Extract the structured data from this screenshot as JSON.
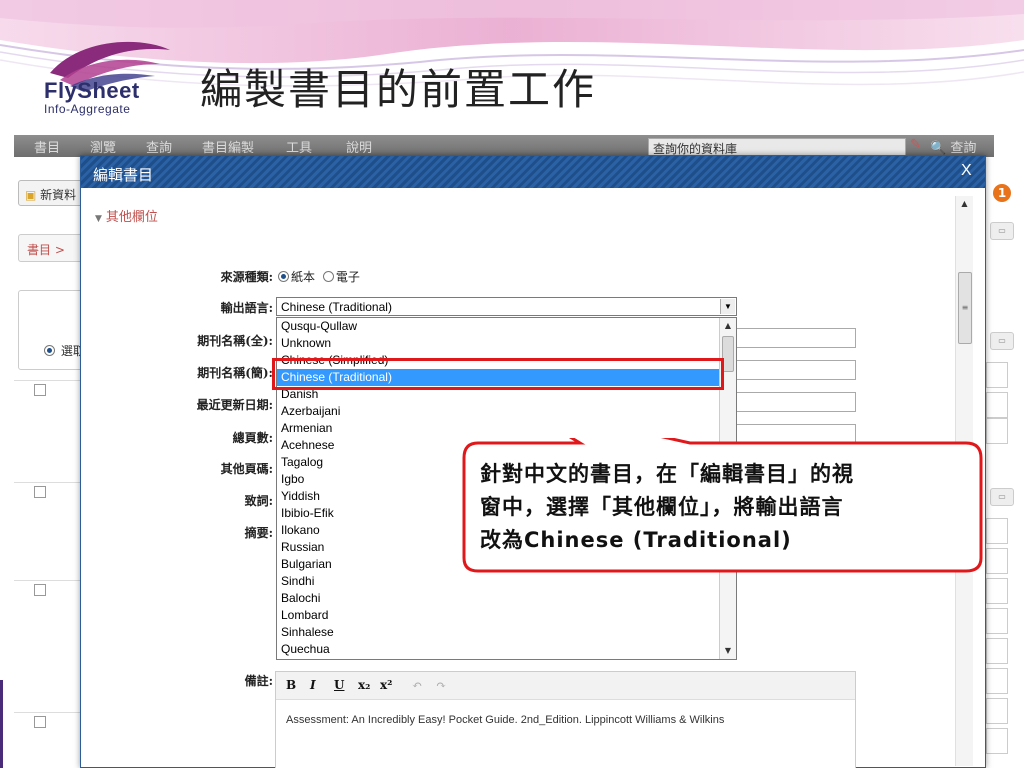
{
  "slide": {
    "logo_main": "FlySheet",
    "logo_sub": "Info-Aggregate",
    "title": "編製書目的前置工作"
  },
  "app": {
    "menu": [
      "書目",
      "瀏覽",
      "查詢",
      "書目編製",
      "工具",
      "說明"
    ],
    "search_placeholder": "查詢你的資料庫",
    "search_button": "查詢",
    "new_button": "新資料",
    "breadcrumb": "書目 >",
    "radio_label": "選取",
    "badge_count": "1"
  },
  "dialog": {
    "title": "編輯書目",
    "close": "X",
    "section": "其他欄位",
    "fields": {
      "source_type": "來源種類:",
      "output_language": "輸出語言:",
      "journal_full": "期刊名稱(全):",
      "journal_abbr": "期刊名稱(簡):",
      "last_updated": "最近更新日期:",
      "total_pages": "總頁數:",
      "other_pages": "其他頁碼:",
      "acknowledgement": "致詞:",
      "abstract": "摘要:",
      "notes": "備註:"
    },
    "source_options": [
      "紙本",
      "電子"
    ],
    "source_selected": "紙本",
    "output_language_value": "Chinese (Traditional)",
    "language_options": [
      "Qusqu-Qullaw",
      "Unknown",
      "Chinese (Simplified)",
      "Chinese (Traditional)",
      "Danish",
      "Azerbaijani",
      "Armenian",
      "Acehnese",
      "Tagalog",
      "Igbo",
      "Yiddish",
      "Ibibio-Efik",
      "Ilokano",
      "Russian",
      "Bulgarian",
      "Sindhi",
      "Balochi",
      "Lombard",
      "Sinhalese",
      "Quechua"
    ],
    "editor_toolbar": [
      "B",
      "I",
      "U",
      "x₂",
      "x²",
      "↶",
      "↷"
    ],
    "notes_text": "Assessment: An Incredibly Easy! Pocket Guide. 2nd_Edition. Lippincott Williams & Wilkins"
  },
  "callout": {
    "line1": "針對中文的書目，在「編輯書目」的視",
    "line2": "窗中，選擇「其他欄位」，將輸出語言",
    "line3": "改為Chinese (Traditional)"
  },
  "colors": {
    "titlebar": "#1f4f8a",
    "highlight": "#e0181b",
    "selection": "#3399ff",
    "section": "#c0504d"
  }
}
